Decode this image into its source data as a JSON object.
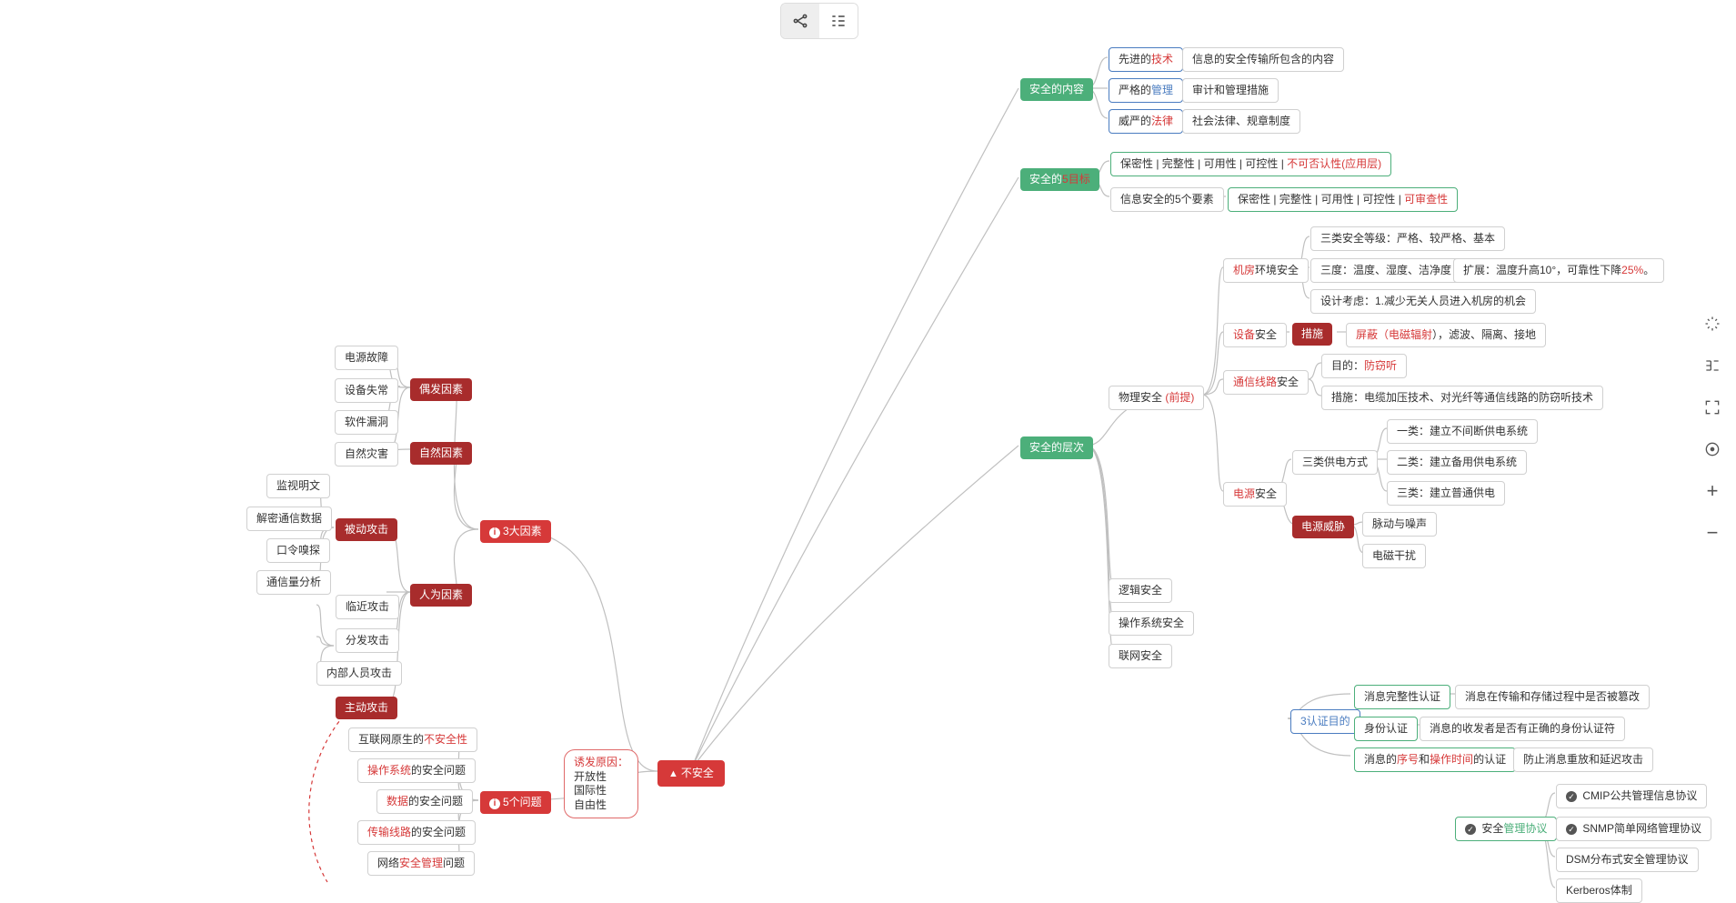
{
  "toolbar": {
    "mindmap": "",
    "outline": ""
  },
  "right_tools": {
    "magic": "",
    "tree": "",
    "fit": "",
    "center": "",
    "zoom_in": "",
    "zoom_out": ""
  },
  "center": {
    "label": "不安全"
  },
  "reasons_box": {
    "title": "诱发原因：",
    "l1": "开放性",
    "l2": "国际性",
    "l3": "自由性"
  },
  "three_factors": {
    "title": "3大因素",
    "accidental": "偶发因素",
    "natural": "自然因素",
    "human": "人为因素"
  },
  "accidental_items": {
    "a": "电源故障",
    "b": "设备失常",
    "c": "软件漏洞"
  },
  "natural_items": {
    "a": "自然灾害"
  },
  "passive_attack": {
    "title": "被动攻击",
    "a": "监视明文",
    "b": "解密通信数据",
    "c": "口令嗅探",
    "d": "通信量分析"
  },
  "human_items": {
    "a": "临近攻击",
    "b": "分发攻击",
    "c": "内部人员攻击"
  },
  "active_attack": {
    "title": "主动攻击"
  },
  "five_problems": {
    "title": "5个问题",
    "a_pre": "互联网原生的",
    "a_red": "不安全性",
    "b_pre": "操作系统",
    "b_rest": "的安全问题",
    "c_pre": "数据",
    "c_rest": "的安全问题",
    "d_pre": "传输线路",
    "d_rest": "的安全问题",
    "e_pre": "网络",
    "e_red": "安全管理",
    "e_rest": "问题"
  },
  "content_sec": {
    "title": "安全的内容",
    "tech_pre": "先进的",
    "tech_red": "技术",
    "tech_r": "信息的安全传输所包含的内容",
    "mgmt_pre": "严格的",
    "mgmt_blue": "管理",
    "mgmt_r": "审计和管理措施",
    "law_pre": "威严的",
    "law_red": "法律",
    "law_r": "社会法律、规章制度"
  },
  "five_goals": {
    "title_pre": "安全的",
    "title_red": "5目标",
    "line1_a": "保密性 | 完整性 | 可用性 | 可控性 |",
    "line1_b": " 不可否认性(应用层)",
    "sub": "信息安全的5个要素",
    "line2_a": "保密性 | 完整性 | 可用性 | 可控性 |",
    "line2_b": " 可审查性"
  },
  "layers": {
    "title": "安全的层次",
    "physical_pre": "物理安全 ",
    "physical_red": "(前提)",
    "logic": "逻辑安全",
    "os": "操作系统安全",
    "net": "联网安全"
  },
  "machine_room": {
    "title_pre": "机房",
    "title_rest": "环境安全",
    "a": "三类安全等级：严格、较严格、基本",
    "b": "三度：温度、湿度、洁净度",
    "b_ext_pre": "扩展：温度升高10°，可靠性下降",
    "b_ext_red": "25%",
    "b_ext_suf": "。",
    "c": "设计考虑：1.减少无关人员进入机房的机会"
  },
  "device_sec": {
    "title_pre": "设备",
    "title_rest": "安全",
    "measures": "措施",
    "detail_pre": "屏蔽（",
    "detail_red": "电磁辐射",
    "detail_suf": "），滤波、隔离、接地"
  },
  "comm_line": {
    "title_pre": "通信线路",
    "title_rest": "安全",
    "goal_pre": "目的：",
    "goal_red": "防窃听",
    "measure": "措施：电缆加压技术、对光纤等通信线路的防窃听技术"
  },
  "power_sec": {
    "title_pre": "电源",
    "title_rest": "安全",
    "three_ways": "三类供电方式",
    "w1": "一类：建立不间断供电系统",
    "w2": "二类：建立备用供电系统",
    "w3": "三类：建立普通供电",
    "threat": "电源威胁",
    "t1": "脉动与噪声",
    "t2": "电磁干扰"
  },
  "auth_goals": {
    "title": "3认证目的",
    "a_title": "消息完整性认证",
    "a_r": "消息在传输和存储过程中是否被篡改",
    "b_title": "身份认证",
    "b_r": "消息的收发者是否有正确的身份认证符",
    "c_pre": "消息的",
    "c_r1": "序号",
    "c_mid": "和",
    "c_r2": "操作时间",
    "c_suf": "的认证",
    "c_r": "防止消息重放和延迟攻击"
  },
  "protocols": {
    "title_pre": "安全",
    "title_green": "管理协议",
    "a": "CMIP公共管理信息协议",
    "b": "SNMP简单网络管理协议",
    "c": "DSM分布式安全管理协议",
    "d": "Kerberos体制"
  }
}
